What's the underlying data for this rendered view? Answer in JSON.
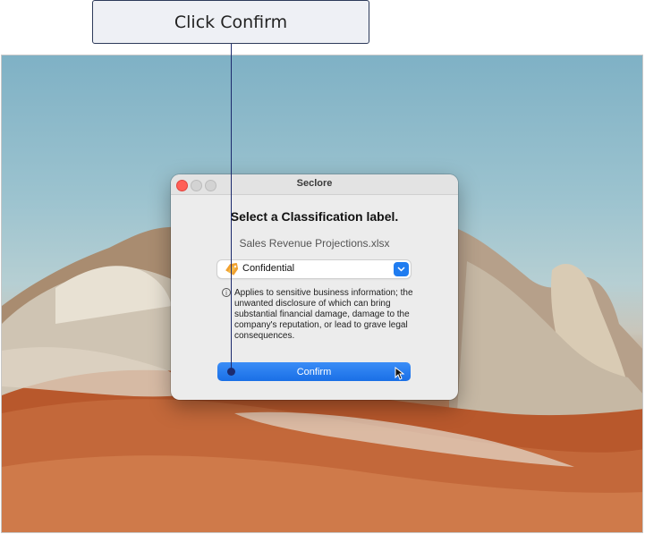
{
  "annotation": {
    "text": "Click Confirm"
  },
  "dialog": {
    "window_title": "Seclore",
    "heading": "Select a Classification label.",
    "filename": "Sales Revenue Projections.xlsx",
    "dropdown": {
      "selected": "Confidential",
      "icon": "tag-icon"
    },
    "info_icon": "info-icon",
    "description": "Applies to sensitive business information; the unwanted disclosure of which can bring substantial financial damage, damage to the company's reputation, or lead to grave legal consequences.",
    "confirm_label": "Confirm"
  },
  "colors": {
    "accent": "#1f7cf0",
    "callout_border": "#2d3a5a",
    "connector": "#1d2b6e",
    "close_button": "#ff5f57"
  }
}
